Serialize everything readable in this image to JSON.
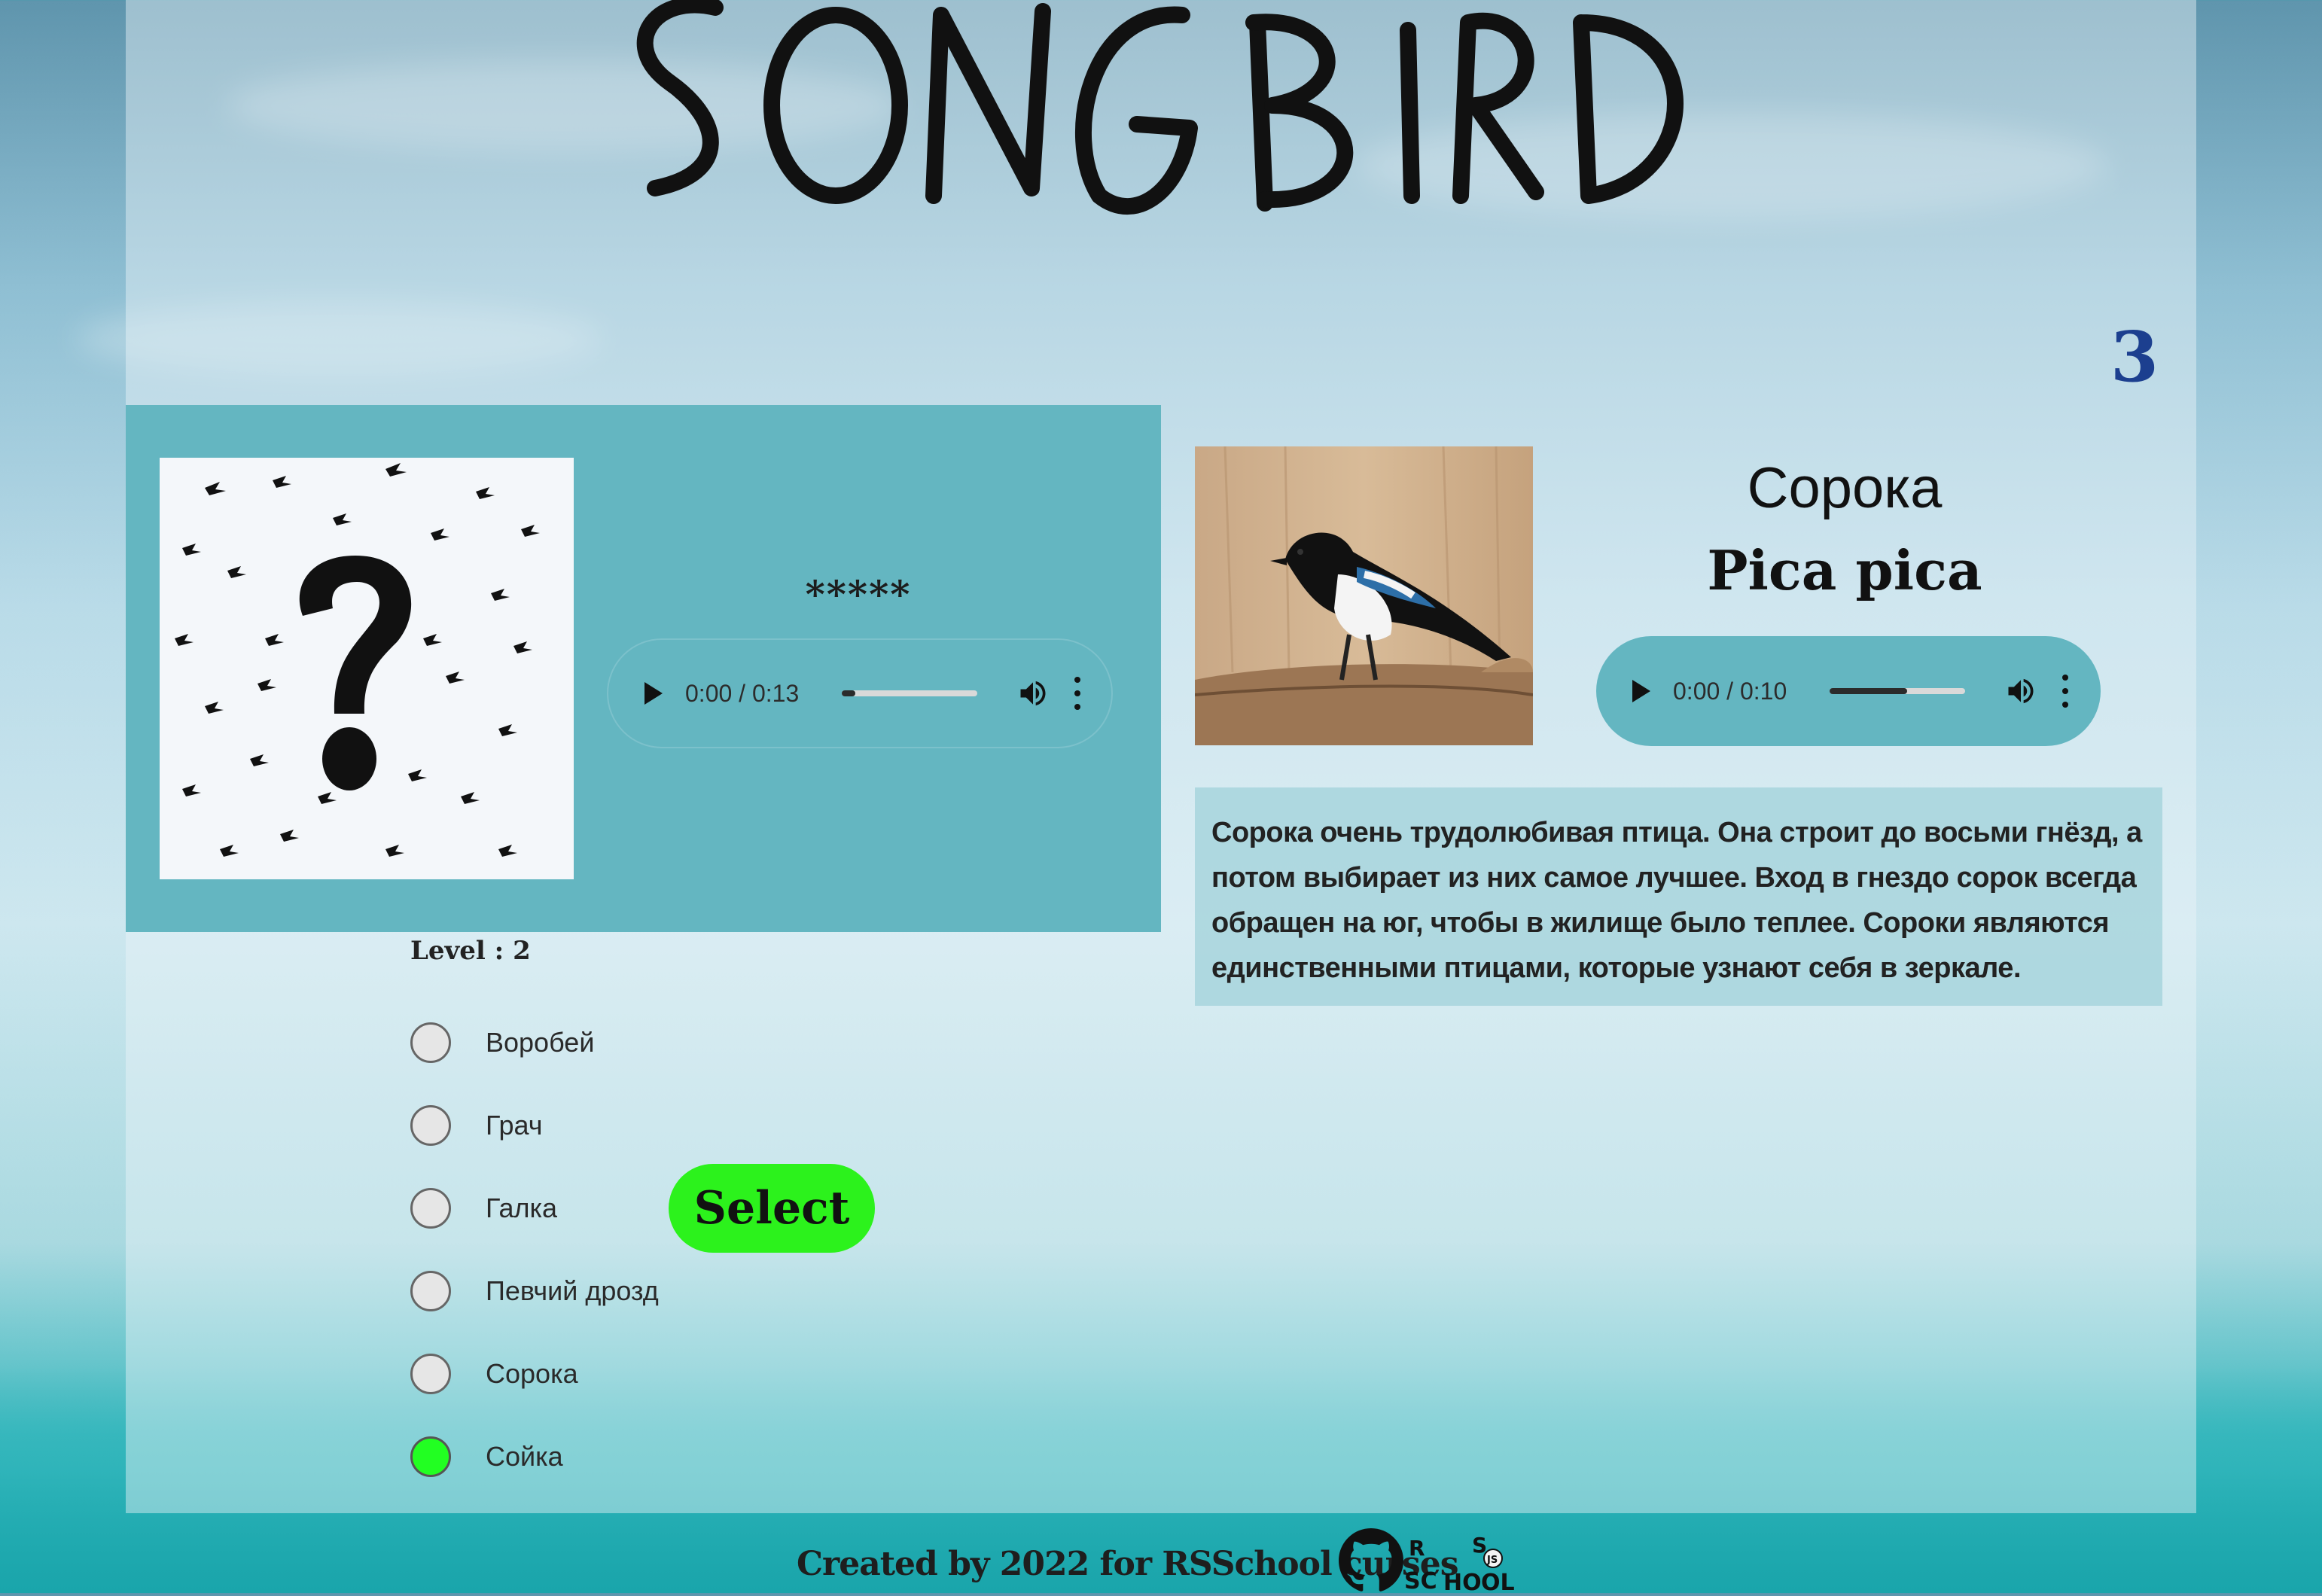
{
  "header": {
    "logo_text": "SONGBIRD",
    "score": "3"
  },
  "question": {
    "hidden_name": "*****",
    "player": {
      "time": "0:00 / 0:13",
      "progress": 0.1
    }
  },
  "quiz": {
    "level_label": "Level : 2",
    "answers": [
      {
        "label": "Воробей",
        "state": "neutral"
      },
      {
        "label": "Грач",
        "state": "neutral"
      },
      {
        "label": "Галка",
        "state": "neutral"
      },
      {
        "label": "Певчий дрозд",
        "state": "neutral"
      },
      {
        "label": "Сорока",
        "state": "neutral"
      },
      {
        "label": "Сойка",
        "state": "correct"
      }
    ],
    "select_label": "Select"
  },
  "answer_card": {
    "name": "Сорока",
    "latin": "Pica pica",
    "player": {
      "time": "0:00 / 0:10",
      "progress": 0.57
    },
    "description": "Сорока очень трудолюбивая птица. Она строит до восьми гнёзд, а потом выбирает из них самое лучшее. Вход в гнездо сорок всегда обращен на юг, чтобы в жилище было теплее. Сороки являются единственными птицами, которые узнают себя в зеркале."
  },
  "footer": {
    "credit": "Created by 2022 for RSSchool curses",
    "rs_logo_text": "RS SCHOOL JS"
  },
  "colors": {
    "accent_green": "#2cf21c",
    "correct_radio": "#22ff22",
    "score_blue": "#1c3f8f",
    "panel_teal": "#64b6c1"
  }
}
